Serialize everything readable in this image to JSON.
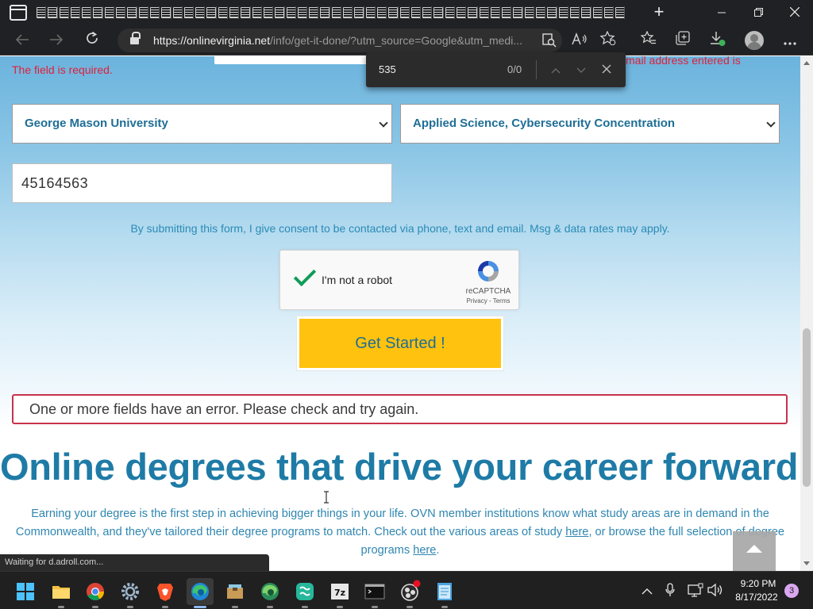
{
  "browser": {
    "new_tab_glyph": "+",
    "url_host": "https://onlinevirginia.net",
    "url_path": "/info/get-it-done/?utm_source=Google&utm_medi...",
    "status_text": "Waiting for d.adroll.com..."
  },
  "find": {
    "query": "535",
    "count": "0/0"
  },
  "form": {
    "required_error": "The field is required.",
    "email_error": "mail address entered is",
    "university_value": "George Mason University",
    "program_value": "Applied Science, Cybersecurity Concentration",
    "phone_value": "45164563",
    "consent_text": "By submitting this form, I give consent to be contacted via phone, text and email. Msg & data rates may apply.",
    "submit_label": "Get Started !",
    "form_error": "One or more fields have an error. Please check and try again."
  },
  "captcha": {
    "label": "I'm not a robot",
    "brand": "reCAPTCHA",
    "links": "Privacy - Terms",
    "checked": true
  },
  "content": {
    "headline": "Online degrees that drive your career forward.",
    "para_1": "Earning your degree is the first step in achieving bigger things in your life. OVN member institutions know what study areas are in demand in the Commonwealth, and they've tailored their degree programs to match. Check out the various areas of study ",
    "link_1": "here",
    "para_2": ", or browse the full selection of degree programs ",
    "link_2": "here",
    "para_3": "."
  },
  "taskbar": {
    "apps": [
      "start-icon",
      "file-explorer-icon",
      "chrome-icon",
      "settings-icon",
      "brave-icon",
      "edge-icon",
      "archive-icon",
      "edge-dev-icon",
      "green-app-icon",
      "7zip-icon",
      "terminal-icon",
      "obs-icon",
      "notepad-icon"
    ],
    "time": "9:20 PM",
    "date": "8/17/2022",
    "notification_count": "3"
  },
  "colors": {
    "accent_blue": "#1e7ba6",
    "button_yellow": "#ffc20e",
    "error_red": "#e0203a"
  }
}
